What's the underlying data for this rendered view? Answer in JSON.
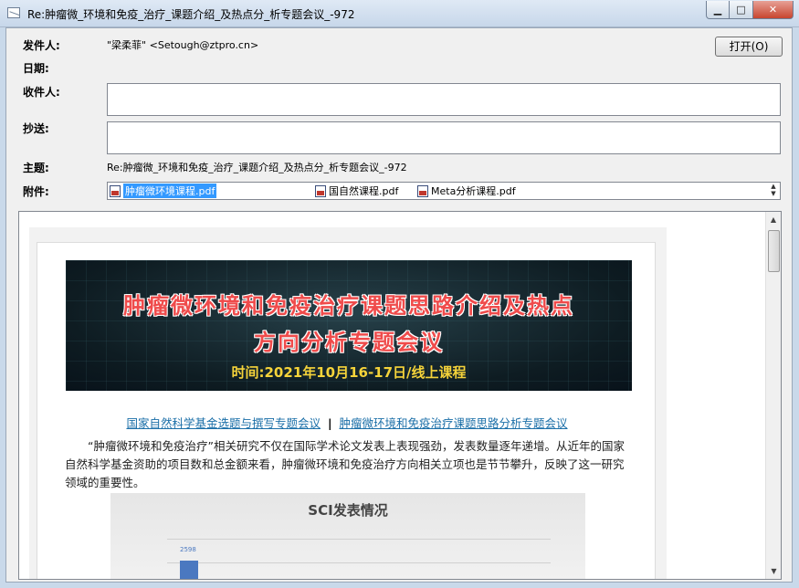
{
  "window": {
    "title": "Re:肿瘤微_环境和免疫_治疗_课题介绍_及热点分_析专题会议_-972",
    "min_label": "▁",
    "max_label": "□",
    "close_label": "✕"
  },
  "header": {
    "from_label": "发件人:",
    "from_value": "\"梁柔菲\" <Setough@ztpro.cn>",
    "date_label": "日期:",
    "date_value": "",
    "to_label": "收件人:",
    "to_value": "",
    "cc_label": "抄送:",
    "cc_value": "",
    "subject_label": "主题:",
    "subject_value": "Re:肿瘤微_环境和免疫_治疗_课题介绍_及热点分_析专题会议_-972",
    "attach_label": "附件:",
    "open_button": "打开(O)"
  },
  "attachments": [
    {
      "name": "肿瘤微环境课程.pdf",
      "selected": true
    },
    {
      "name": "国自然课程.pdf",
      "selected": false
    },
    {
      "name": "Meta分析课程.pdf",
      "selected": false
    }
  ],
  "message": {
    "banner_line1": "肿瘤微环境和免疫治疗课题思路介绍及热点",
    "banner_line2": "方向分析专题会议",
    "banner_time": "时间:2021年10月16-17日/线上课程",
    "link1": "国家自然科学基金选题与撰写专题会议",
    "separator": "|",
    "link2": "肿瘤微环境和免疫治疗课题思路分析专题会议",
    "paragraph": "“肿瘤微环境和免疫治疗”相关研究不仅在国际学术论文发表上表现强劲，发表数量逐年递增。从近年的国家自然科学基金资助的项目数和总金额来看，肿瘤微环境和免疫治疗方向相关立项也是节节攀升，反映了这一研究领域的重要性。",
    "chart_title": "SCI发表情况",
    "chart_bar_label": "2598"
  },
  "colors": {
    "link": "#1b6fa8",
    "banner_title": "#ef4b4b",
    "banner_time": "#f5d33a",
    "selection": "#3399ff"
  }
}
